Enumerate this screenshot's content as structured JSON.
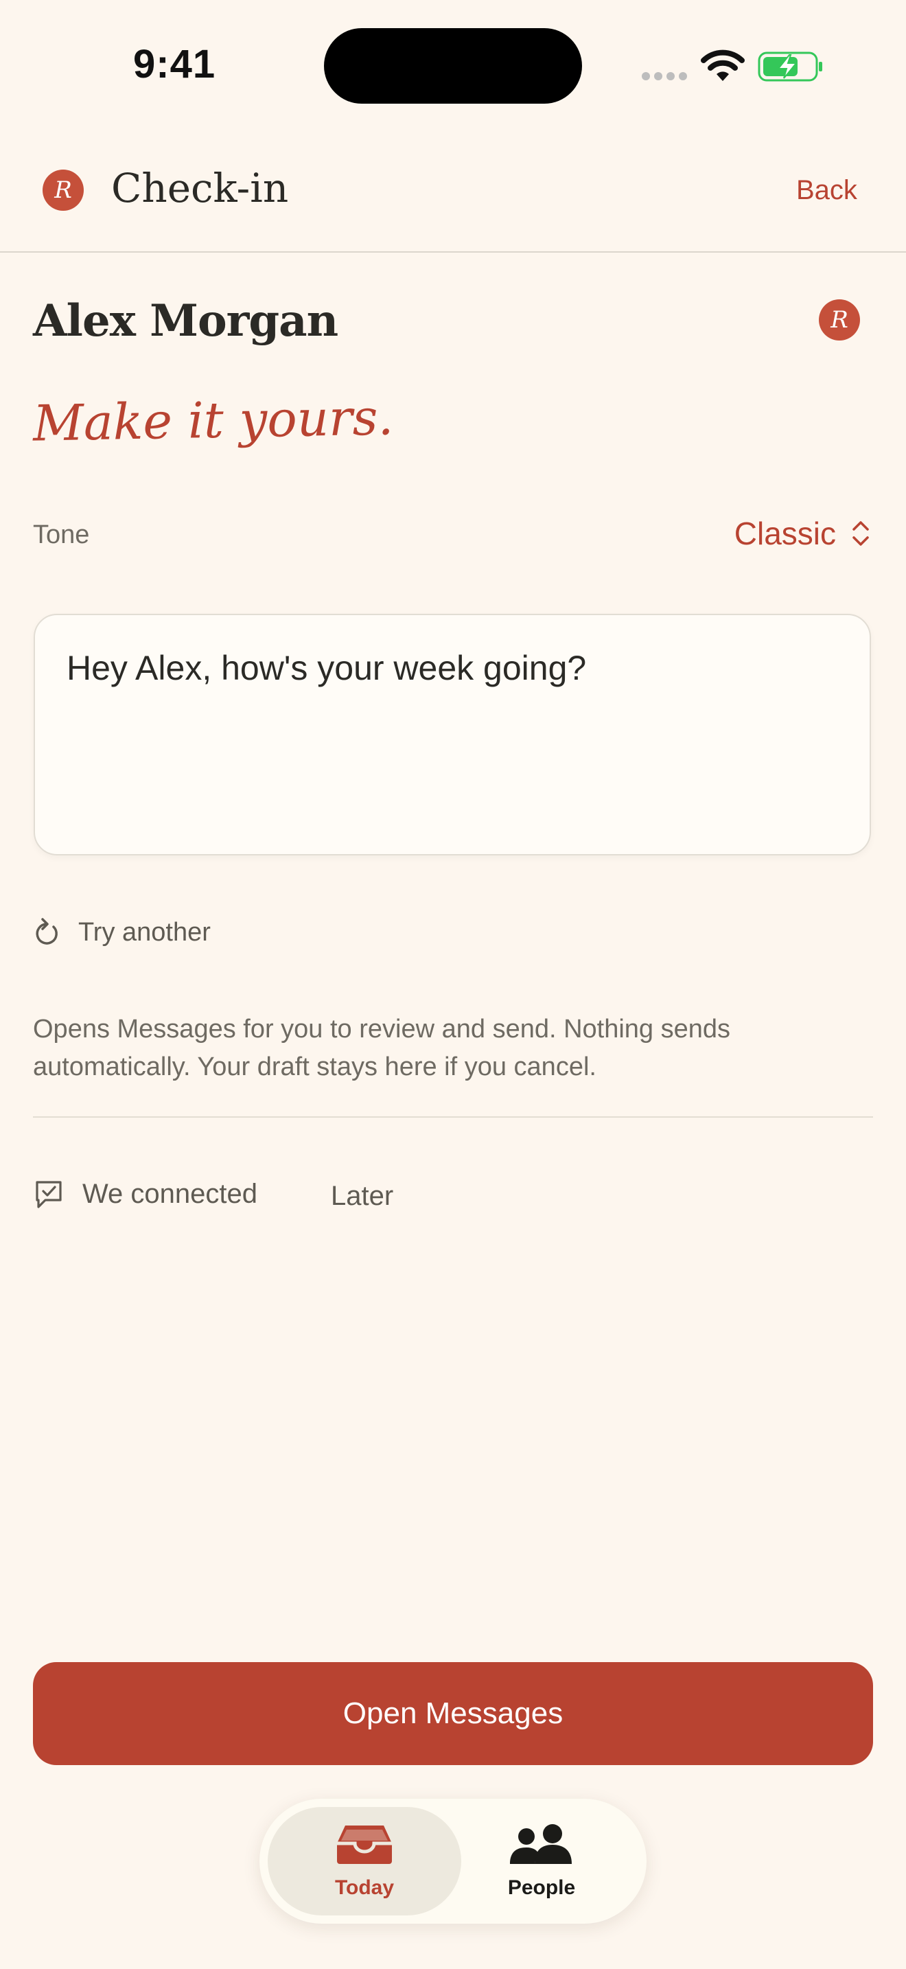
{
  "status_bar": {
    "time": "9:41"
  },
  "header": {
    "title": "Check-in",
    "back_label": "Back",
    "logo_letter": "R"
  },
  "contact": {
    "name": "Alex Morgan",
    "logo_letter": "R"
  },
  "tagline": "Make it yours.",
  "tone": {
    "label": "Tone",
    "value": "Classic"
  },
  "message": {
    "text": "Hey Alex, how's your week going?"
  },
  "actions": {
    "try_another": "Try another",
    "info": "Opens Messages for you to review and send. Nothing sends automatically. Your draft stays here if you cancel.",
    "connected": "We connected",
    "later": "Later",
    "open_messages": "Open Messages"
  },
  "tabbar": {
    "tabs": [
      {
        "label": "Today",
        "icon": "tray-icon",
        "active": true
      },
      {
        "label": "People",
        "icon": "people-icon",
        "active": false
      }
    ]
  },
  "colors": {
    "accent": "#b84331",
    "background": "#fdf6ee",
    "battery_green": "#34c759"
  }
}
